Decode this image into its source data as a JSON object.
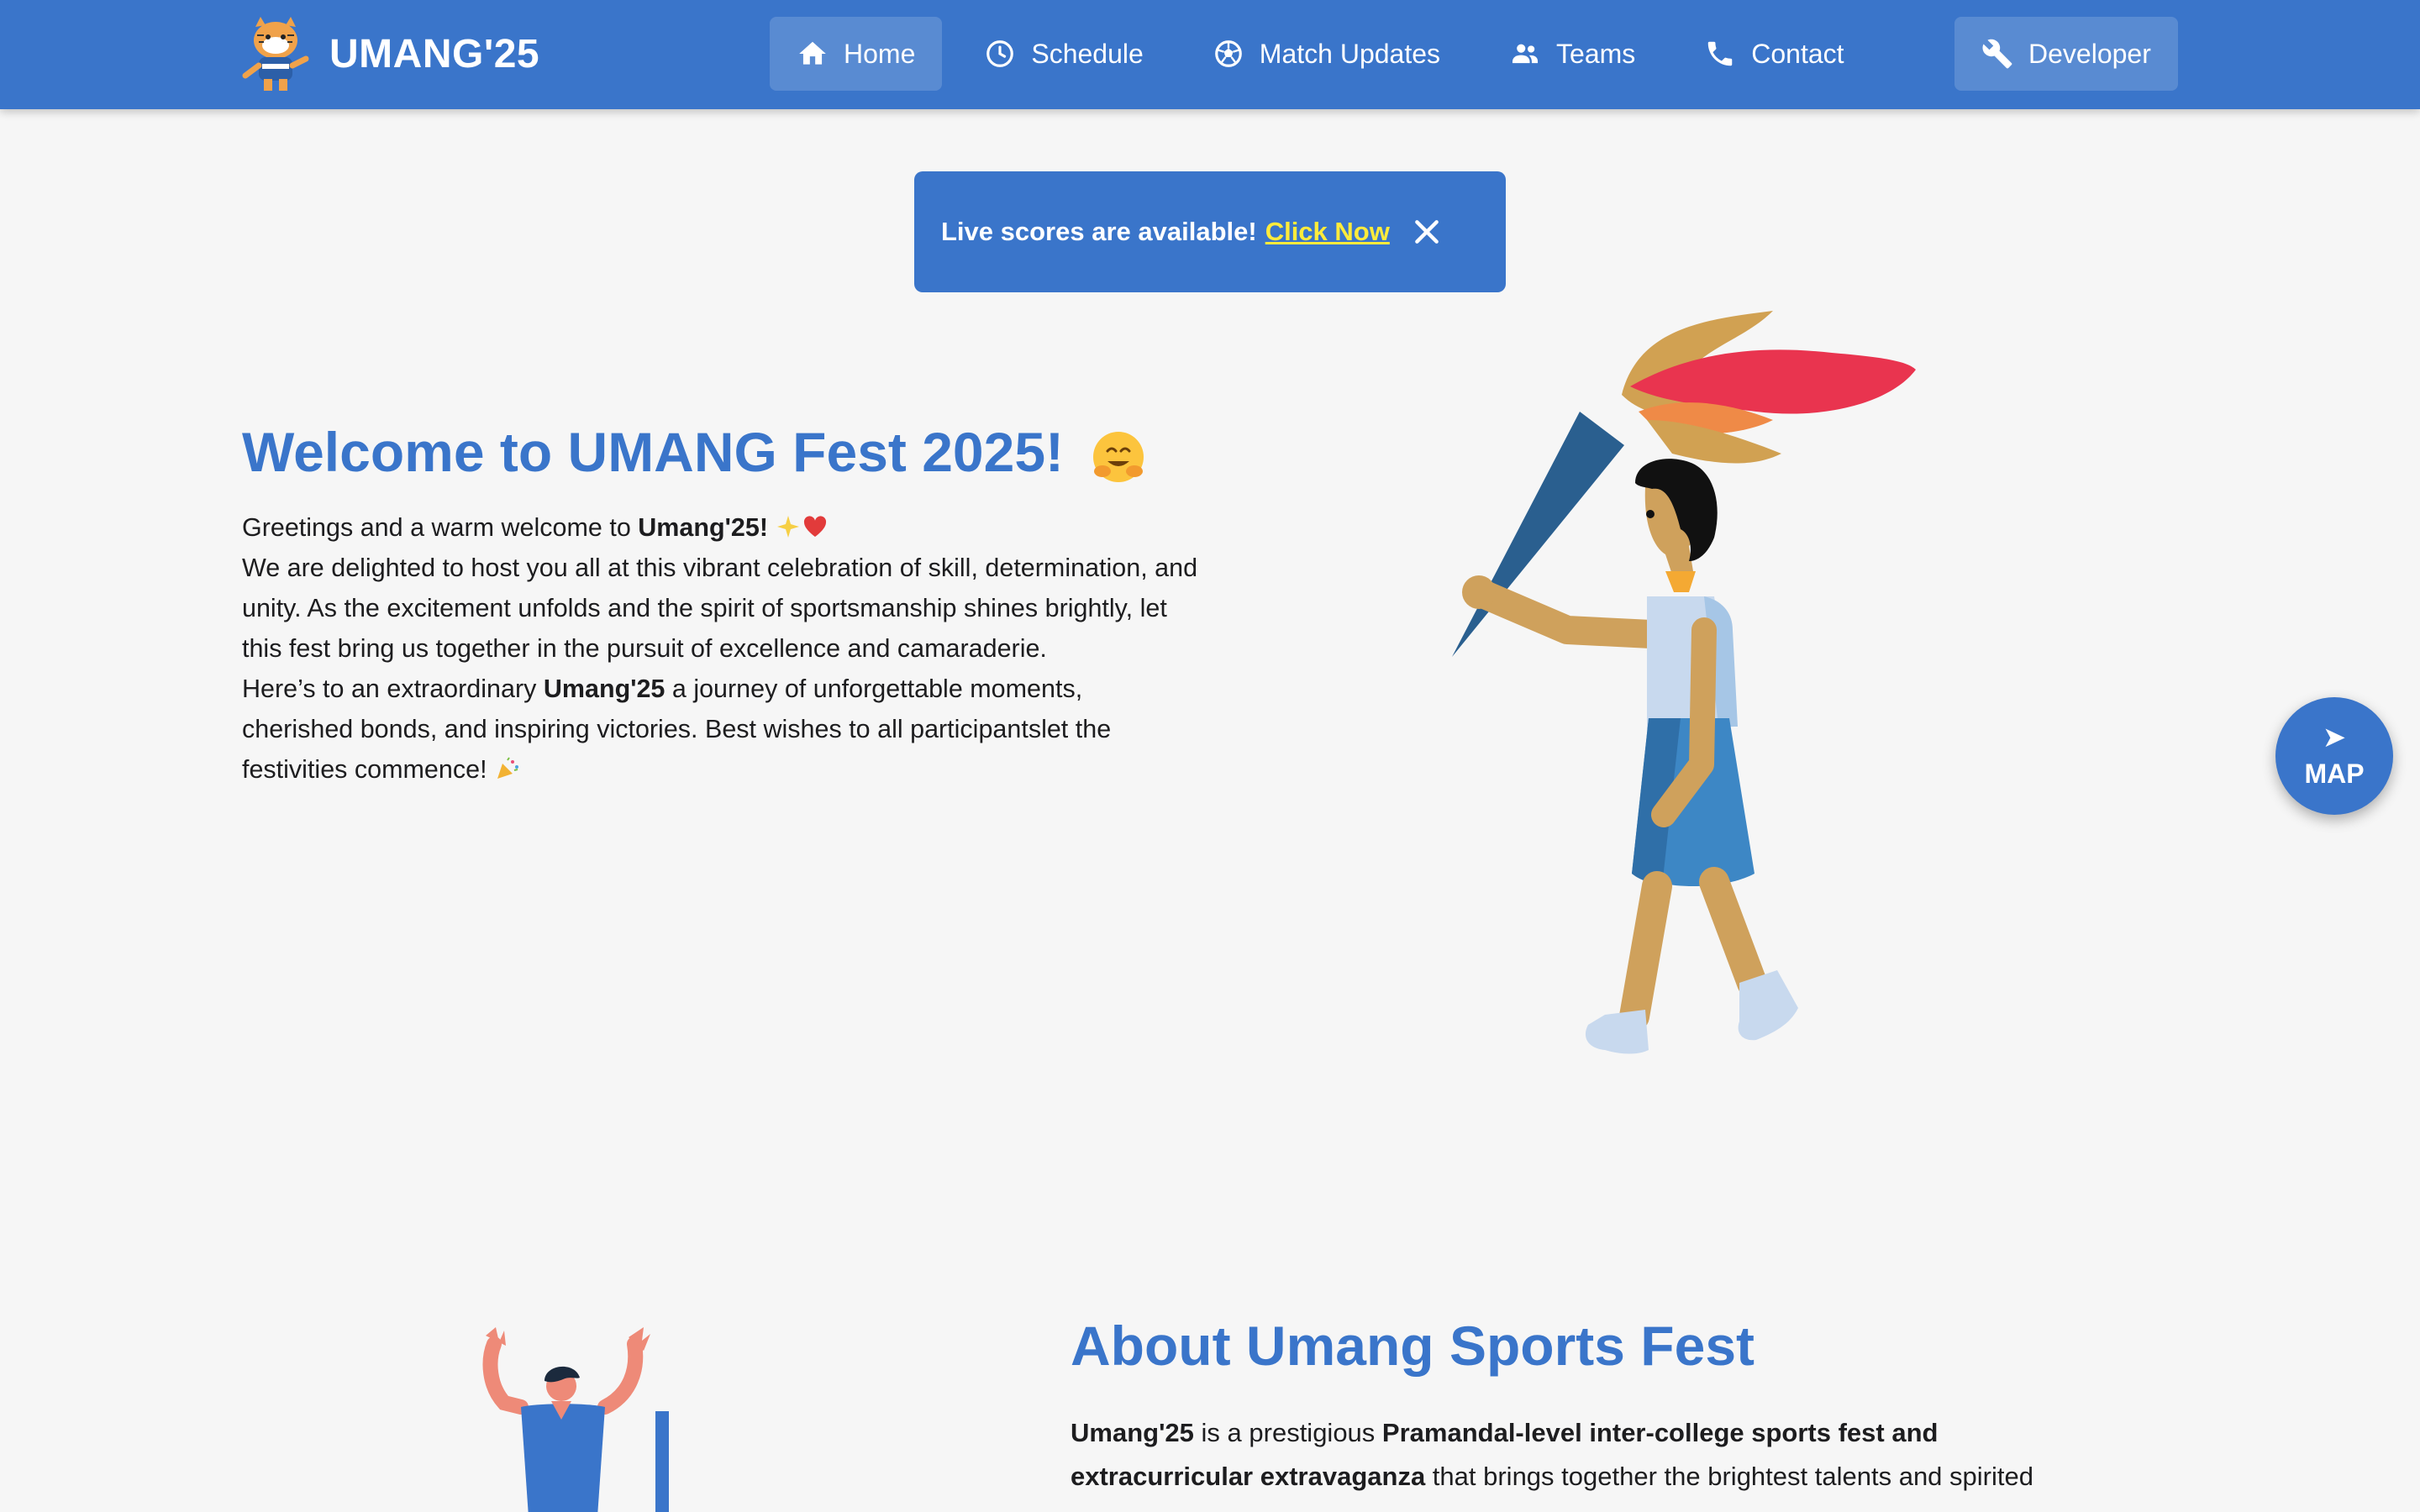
{
  "brand": {
    "name": "UMANG'25",
    "logo_icon": "tiger-mascot-icon"
  },
  "nav": {
    "items": [
      {
        "label": "Home",
        "icon": "home-icon",
        "active": true
      },
      {
        "label": "Schedule",
        "icon": "clock-icon"
      },
      {
        "label": "Match Updates",
        "icon": "soccer-ball-icon"
      },
      {
        "label": "Teams",
        "icon": "people-icon"
      },
      {
        "label": "Contact",
        "icon": "phone-icon"
      },
      {
        "label": "Developer",
        "icon": "wrench-icon"
      }
    ]
  },
  "toast": {
    "message": "Live scores are available!",
    "link_label": "Click Now",
    "close_icon": "close-icon"
  },
  "hero": {
    "title": "Welcome to UMANG Fest 2025!",
    "title_emoji": "hugging-face-icon",
    "line1_prefix": "Greetings and a warm welcome to ",
    "line1_bold": "Umang'25!",
    "para1": "We are delighted to host you all at this vibrant celebration of skill, determination, and unity. As the excitement unfolds and the spirit of sportsmanship shines brightly, let this fest bring us together in the pursuit of excellence and camaraderie.",
    "para2_prefix": "Here’s to an extraordinary ",
    "para2_bold": "Umang'25",
    "para2_suffix": " a journey of unforgettable moments, cherished bonds, and inspiring victories. Best wishes to all participantslet the festivities commence!"
  },
  "map_fab": {
    "arrow": "➤",
    "label": "MAP"
  },
  "about": {
    "title": "About Umang Sports Fest",
    "bold1": "Umang'25",
    "text1": " is a prestigious ",
    "bold2": "Pramandal-level inter-college sports fest and extracurricular extravaganza",
    "text2": " that brings together the brightest talents and spirited"
  },
  "colors": {
    "primary": "#3a75ca",
    "background": "#f6f6f6",
    "link_highlight": "#ffeb3b"
  }
}
